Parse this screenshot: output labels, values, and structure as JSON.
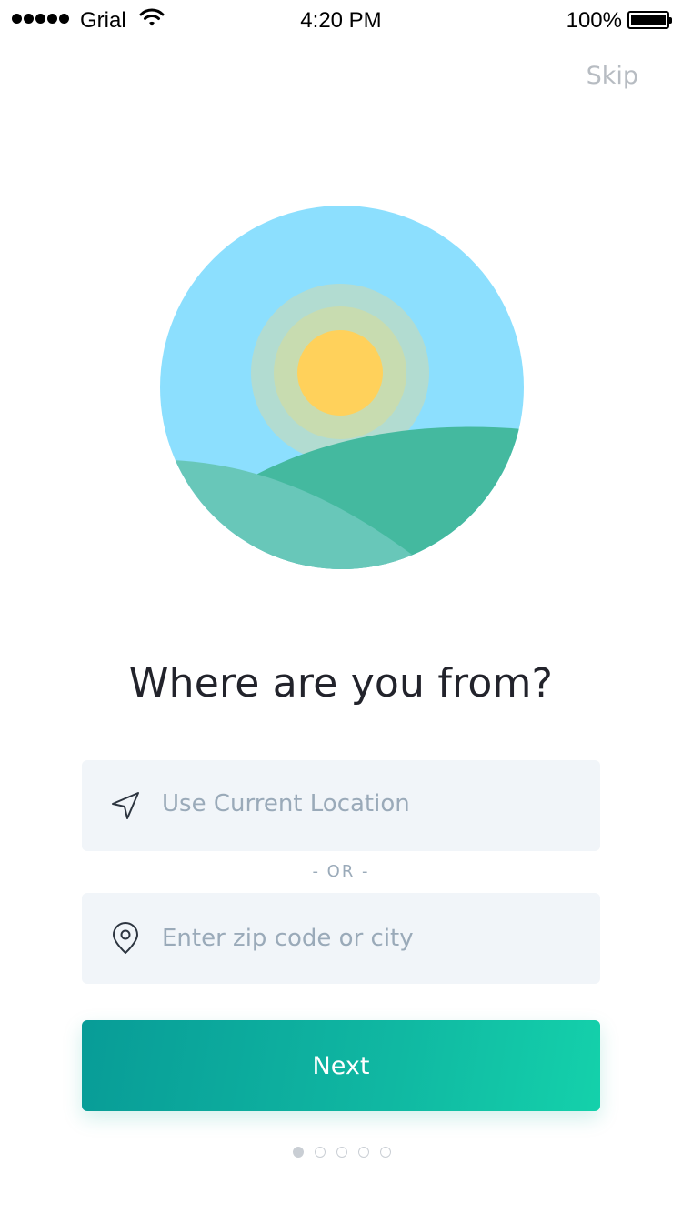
{
  "status_bar": {
    "carrier": "Grial",
    "time": "4:20 PM",
    "battery_percent": "100%",
    "signal_bars": 5,
    "battery_level": 1.0
  },
  "header": {
    "skip_label": "Skip"
  },
  "hero": {
    "icon": "landscape-sun-illustration",
    "colors": {
      "sky": "#8cdffe",
      "sun": "#ffd15b",
      "hill_back": "#44b99f",
      "hill_front": "#68c7b9"
    }
  },
  "main": {
    "title": "Where are you from?",
    "current_location": {
      "label": "Use Current Location",
      "icon": "navigation-arrow-icon"
    },
    "separator": "- OR -",
    "zip_input": {
      "placeholder": "Enter zip code or city",
      "value": "",
      "icon": "map-pin-icon"
    },
    "next_button": {
      "label": "Next"
    }
  },
  "pagination": {
    "total": 5,
    "current": 1
  },
  "colors": {
    "accent_start": "#089c97",
    "accent_end": "#14d1ab",
    "field_background": "#f1f5f9",
    "placeholder": "#9aaab9",
    "title": "#22232b"
  }
}
